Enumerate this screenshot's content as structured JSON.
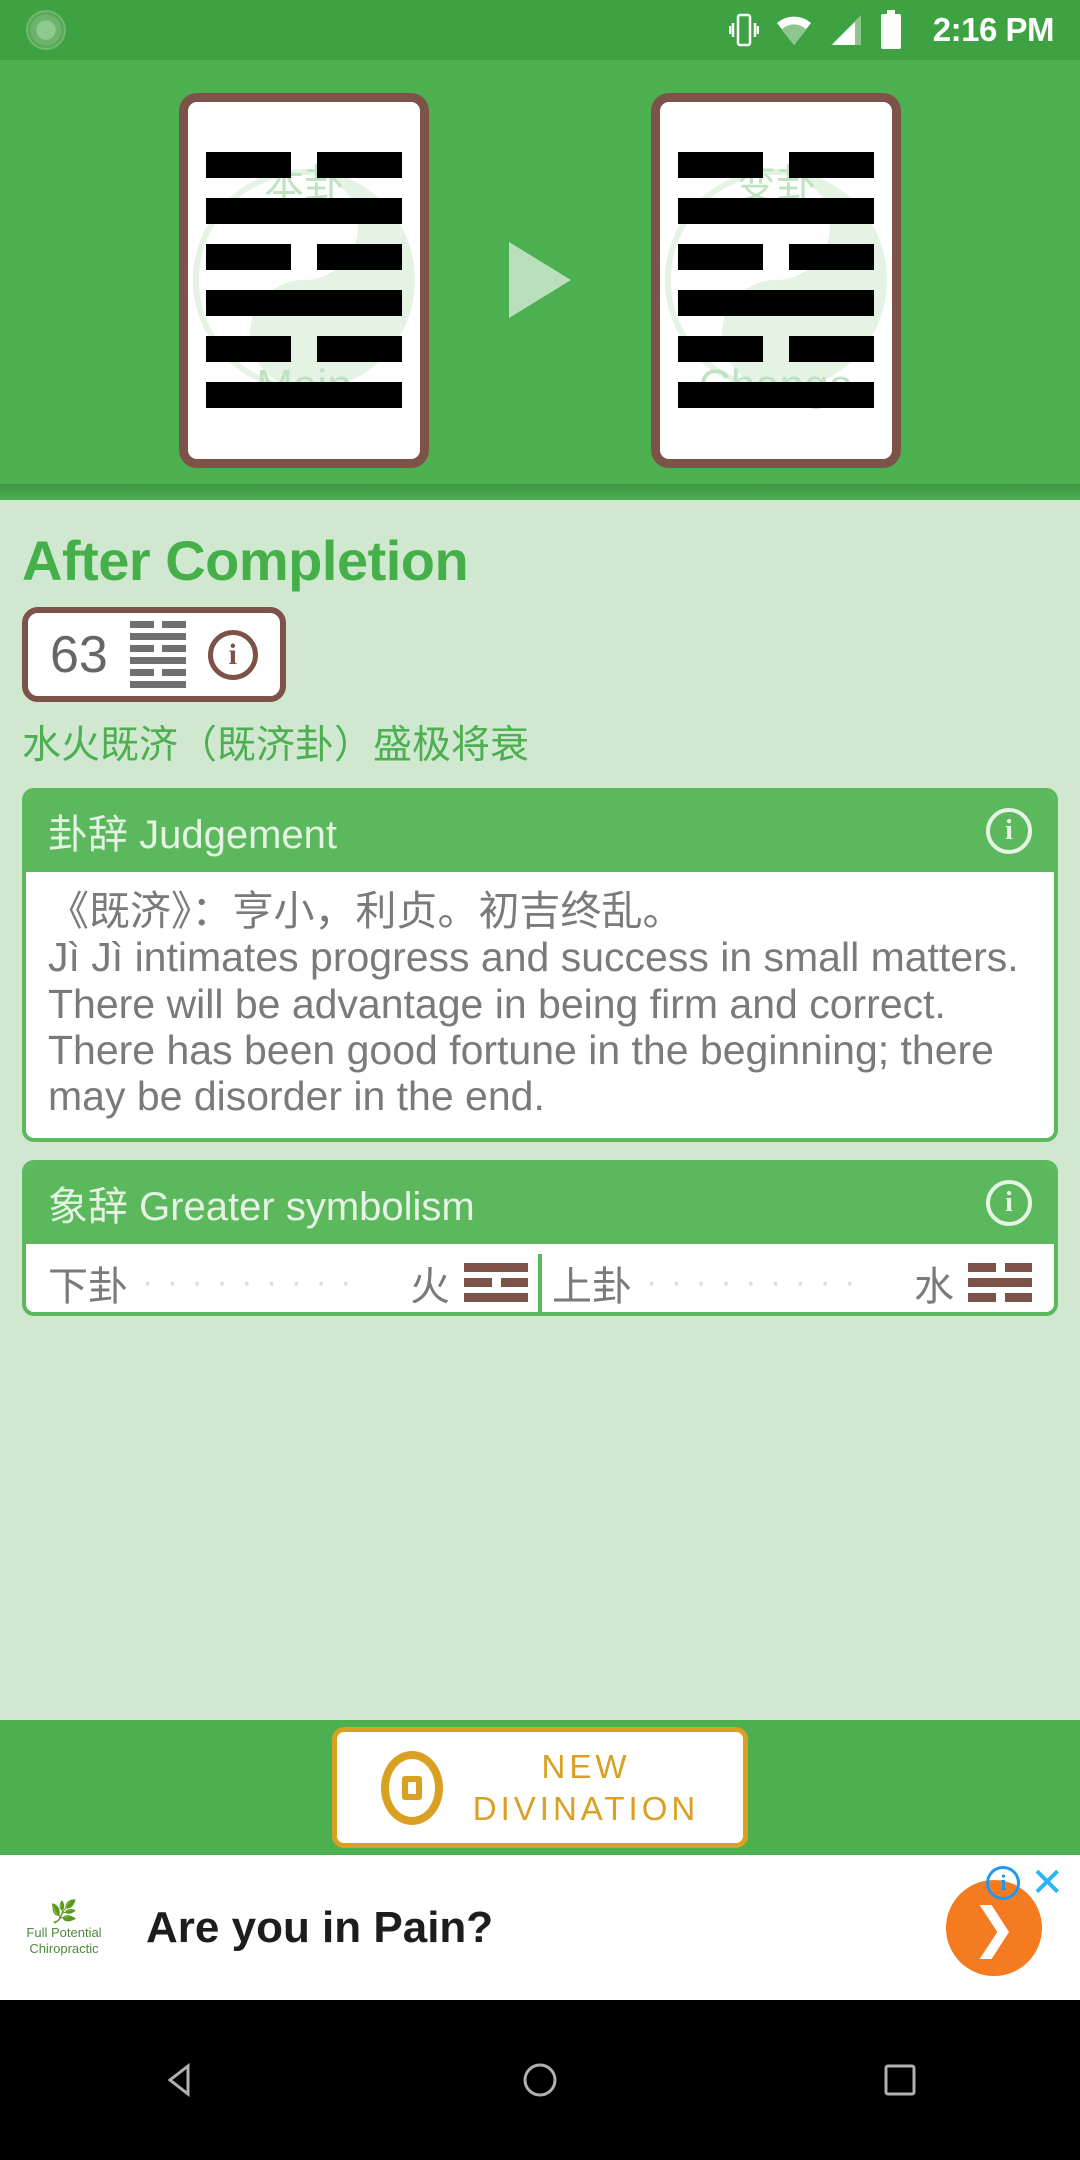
{
  "status_bar": {
    "time": "2:16 PM",
    "icons": [
      "app-icon",
      "vibrate-icon",
      "wifi-icon",
      "signal-icon",
      "battery-icon"
    ]
  },
  "hero": {
    "main_card": {
      "watermark_cn": "本卦",
      "watermark_en": "Main",
      "lines": [
        "broken",
        "solid",
        "broken",
        "solid",
        "broken",
        "solid"
      ]
    },
    "arrow": "▶",
    "change_card": {
      "watermark_cn": "变卦",
      "watermark_en": "Change",
      "lines": [
        "broken",
        "solid",
        "broken",
        "solid",
        "broken",
        "solid"
      ]
    }
  },
  "hexagram": {
    "title": "After Completion",
    "number": "63",
    "subtitle": "水火既济（既济卦）盛极将衰",
    "info_icon": "info-icon",
    "mini_lines": [
      "broken",
      "solid",
      "broken",
      "solid",
      "broken",
      "solid"
    ]
  },
  "judgement": {
    "header": "卦辞 Judgement",
    "info_icon": "info-icon",
    "chinese": "《既济》：亨小，利贞。初吉终乱。",
    "english": "Jì Jì intimates progress and success in small matters. There will be advantage in being firm and correct. There has been good fortune in the beginning; there may be disorder in the end."
  },
  "symbolism": {
    "header": "象辞 Greater symbolism",
    "info_icon": "info-icon",
    "lower_label": "下卦",
    "lower_element": "火",
    "upper_label": "上卦",
    "upper_element": "水",
    "dots": "· · · · · · · · ·"
  },
  "action_bar": {
    "button_line1": "NEW",
    "button_line2": "DIVINATION",
    "coin_icon": "coin-icon"
  },
  "ad": {
    "advertiser_line1": "Full Potential",
    "advertiser_line2": "Chiropractic",
    "headline": "Are you in Pain?",
    "cta_icon": "arrow-right-icon",
    "info_icon": "ad-info-icon",
    "close_icon": "ad-close-icon"
  },
  "nav_bar": {
    "back": "back-button",
    "home": "home-button",
    "recents": "recents-button"
  },
  "colors": {
    "brand_green": "#4caf50",
    "light_green": "#cfe8cf",
    "card_border_brown": "#7d5248",
    "accent_gold": "#d9a021",
    "ad_orange": "#f47b20"
  }
}
